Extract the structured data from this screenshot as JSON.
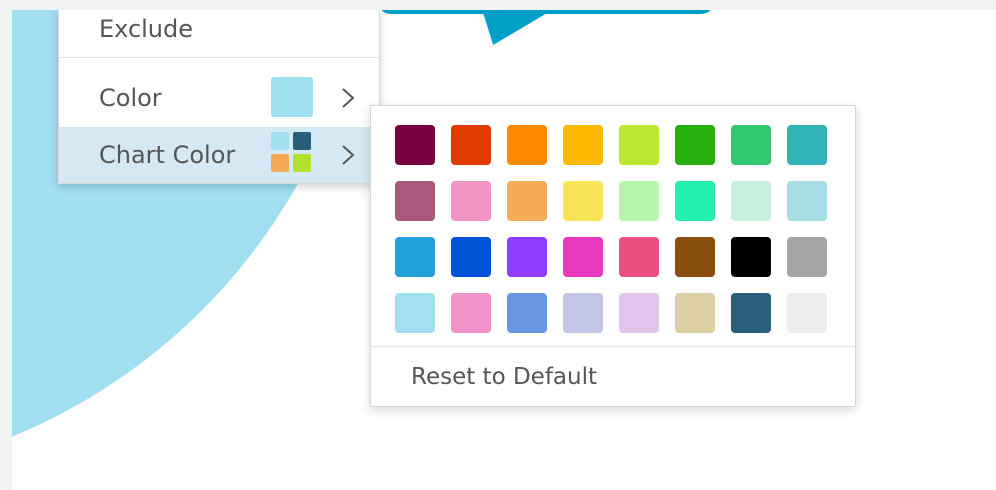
{
  "menu": {
    "items": [
      {
        "id": "exclude",
        "label": "Exclude"
      },
      {
        "id": "color",
        "label": "Color",
        "swatch": "#a0dff0"
      },
      {
        "id": "chart-color",
        "label": "Chart Color",
        "swatch_colors": [
          "#a0dff0",
          "#275e7a",
          "#f5a855",
          "#b3df2e"
        ]
      }
    ],
    "highlight_color": "#d5e9f5"
  },
  "callout": {
    "color": "#009fca"
  },
  "pie": {
    "color": "#a0dff0"
  },
  "palette": {
    "rows": [
      [
        "#7a0041",
        "#e03b00",
        "#ff8a00",
        "#ffb800",
        "#bde830",
        "#27ad0c",
        "#35c872",
        "#31b3b8"
      ],
      [
        "#a95a7c",
        "#f195c7",
        "#f6ab57",
        "#f9e356",
        "#b6f5ab",
        "#24efb1",
        "#c6f0dc",
        "#a6dce3"
      ],
      [
        "#24a0dd",
        "#0053d6",
        "#8e3cff",
        "#e83abf",
        "#eb4f80",
        "#8a4f10",
        "#000000",
        "#a5a5a5"
      ],
      [
        "#a3dff1",
        "#ef93ca",
        "#6997e1",
        "#c3c5e6",
        "#e1c5ed",
        "#dccfa4",
        "#2a5e7b",
        "#eeeeee"
      ]
    ],
    "reset_label": "Reset to Default"
  }
}
